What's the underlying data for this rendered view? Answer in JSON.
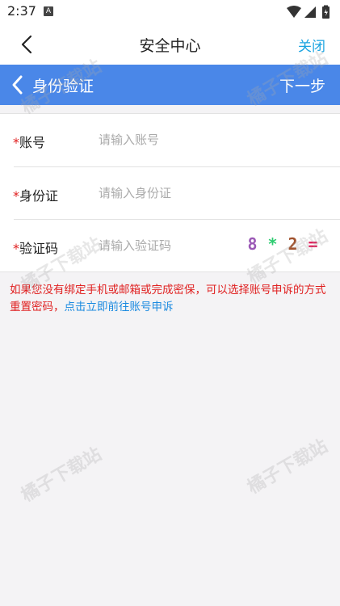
{
  "status_bar": {
    "time": "2:37",
    "notification_badge": "A",
    "icons": [
      "wifi-icon",
      "signal-icon",
      "battery-icon"
    ]
  },
  "top_bar": {
    "title": "安全中心",
    "close_label": "关闭"
  },
  "sub_header": {
    "title": "身份验证",
    "next_label": "下一步"
  },
  "form": {
    "required_mark": "*",
    "account": {
      "label": "账号",
      "placeholder": "请输入账号",
      "value": ""
    },
    "id_card": {
      "label": "身份证",
      "placeholder": "请输入身份证",
      "value": ""
    },
    "captcha": {
      "label": "验证码",
      "placeholder": "请输入验证码",
      "value": "",
      "image_text": [
        "8",
        "*",
        "2",
        "="
      ]
    }
  },
  "notice": {
    "text": "如果您没有绑定手机或邮箱或完成密保，可以选择账号申诉的方式重置密码，",
    "link": "点击立即前往账号申诉"
  },
  "watermark_text": "橘子下载站",
  "colors": {
    "brand_blue": "#4a87e8",
    "link_blue": "#1a8ae0",
    "close_blue": "#1aa3e0",
    "error_red": "#e02020",
    "background": "#f4f3f5"
  }
}
